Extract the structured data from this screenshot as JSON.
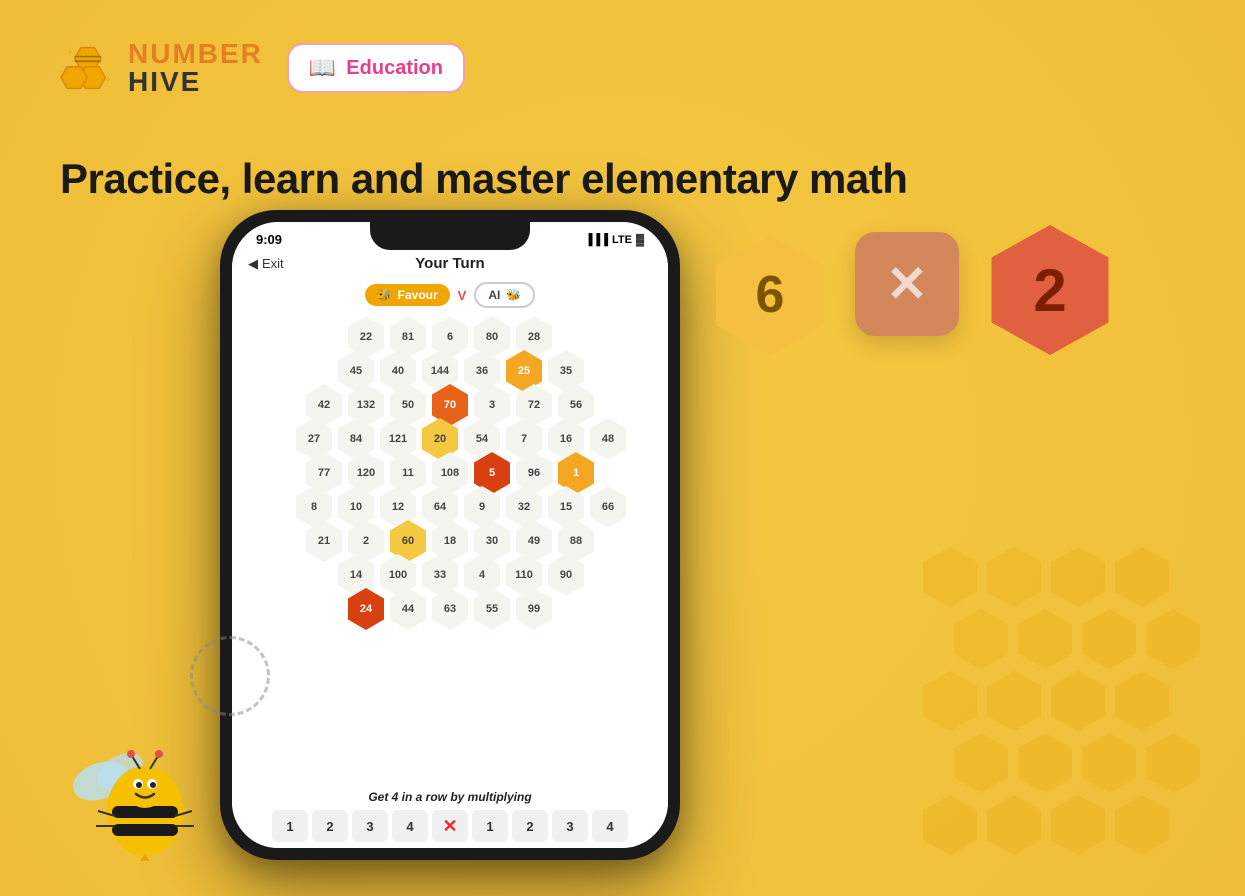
{
  "app": {
    "background_color": "#f5c842"
  },
  "header": {
    "logo_top": "NUMBER",
    "logo_bottom": "HIVE",
    "education_icon": "📖",
    "education_label": "Education"
  },
  "headline": "Practice, learn and master  elementary math",
  "phone": {
    "status_bar": {
      "time": "9:09",
      "signal": "▐▐▐",
      "network": "LTE",
      "battery": "🔋"
    },
    "game_title": "Your Turn",
    "exit_label": "Exit",
    "player1": {
      "name": "Favour",
      "icon": "🐝"
    },
    "vs": "V",
    "player2": {
      "name": "AI",
      "icon": "🐝"
    },
    "hex_grid": [
      [
        "22",
        "81",
        "6",
        "80",
        "28"
      ],
      [
        "45",
        "40",
        "144",
        "36",
        "25",
        "35"
      ],
      [
        "42",
        "132",
        "50",
        "70",
        "3",
        "72",
        "56"
      ],
      [
        "27",
        "84",
        "121",
        "20",
        "54",
        "7",
        "16",
        "48"
      ],
      [
        "77",
        "120",
        "11",
        "108",
        "5",
        "96",
        "1"
      ],
      [
        "8",
        "10",
        "12",
        "64",
        "9",
        "32",
        "15",
        "66"
      ],
      [
        "21",
        "2",
        "60",
        "18",
        "30",
        "49",
        "88"
      ],
      [
        "14",
        "100",
        "33",
        "4",
        "110",
        "90"
      ],
      [
        "24",
        "44",
        "63",
        "55",
        "99"
      ]
    ],
    "instruction": "Get 4 in a row by multiplying",
    "bottom_numbers": [
      "1",
      "2",
      "3",
      "4",
      "✕",
      "1",
      "2",
      "3",
      "4"
    ]
  },
  "decorations": {
    "hex6_value": "6",
    "hex2_value": "2"
  }
}
